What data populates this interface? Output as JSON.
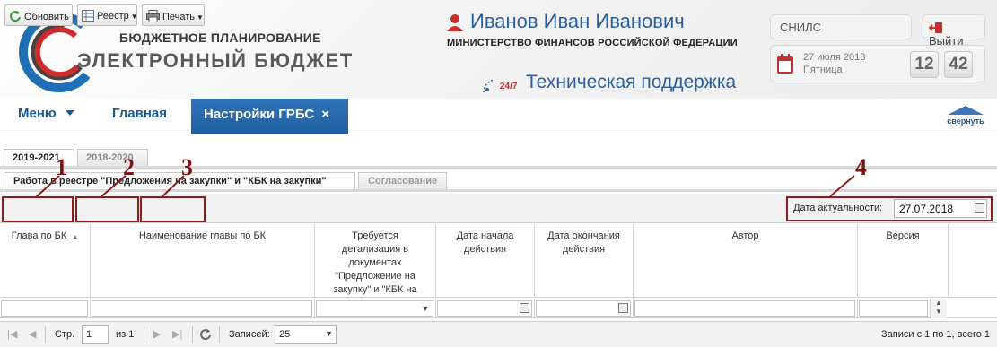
{
  "header": {
    "logo_line1": "БЮДЖЕТНОЕ ПЛАНИРОВАНИЕ",
    "logo_line2": "ЭЛЕКТРОННЫЙ БЮДЖЕТ",
    "user_name": "Иванов Иван Иванович",
    "ministry": "МИНИСТЕРСТВО ФИНАНСОВ РОССИЙСКОЙ ФЕДЕРАЦИИ",
    "support_badge": "24/7",
    "support_text": "Техническая поддержка",
    "snils_label": "СНИЛС",
    "logout_label": "Выйти",
    "date": "27 июля 2018",
    "weekday": "Пятница",
    "clock_hours": "12",
    "clock_minutes": "42"
  },
  "nav": {
    "menu_label": "Меню",
    "home_label": "Главная",
    "active_tab_label": "Настройки ГРБС",
    "active_tab_close": "×",
    "collapse_label": "свернуть"
  },
  "year_tabs": [
    {
      "label": "2019-2021",
      "active": true
    },
    {
      "label": "2018-2020",
      "active": false
    }
  ],
  "sub_tabs": [
    {
      "label": "Работа в реестре \"Предложения на закупки\" и \"КБК на закупки\"",
      "active": true
    },
    {
      "label": "Согласование",
      "active": false
    }
  ],
  "toolbar": {
    "refresh_label": "Обновить",
    "registry_label": "Реестр",
    "print_label": "Печать",
    "date_label": "Дата актуальности:",
    "date_value": "27.07.2018"
  },
  "callouts": [
    "1",
    "2",
    "3",
    "4"
  ],
  "grid": {
    "columns": [
      "Глава по БК",
      "Наименование главы по БК",
      "Требуется детализация в документах \"Предложение на закупку\" и \"КБК на закупку\"",
      "Дата начала действия",
      "Дата окончания действия",
      "Автор",
      "Версия"
    ],
    "sort_indicator": "▲"
  },
  "paging": {
    "page_label": "Стр.",
    "page_value": "1",
    "of_label": "из 1",
    "records_label": "Записей:",
    "records_value": "25",
    "summary": "Записи с 1 по 1, всего 1"
  },
  "colors": {
    "accent_blue": "#2a5f9e",
    "nav_tab": "#2f74ba",
    "callout": "#8b1d1d"
  }
}
